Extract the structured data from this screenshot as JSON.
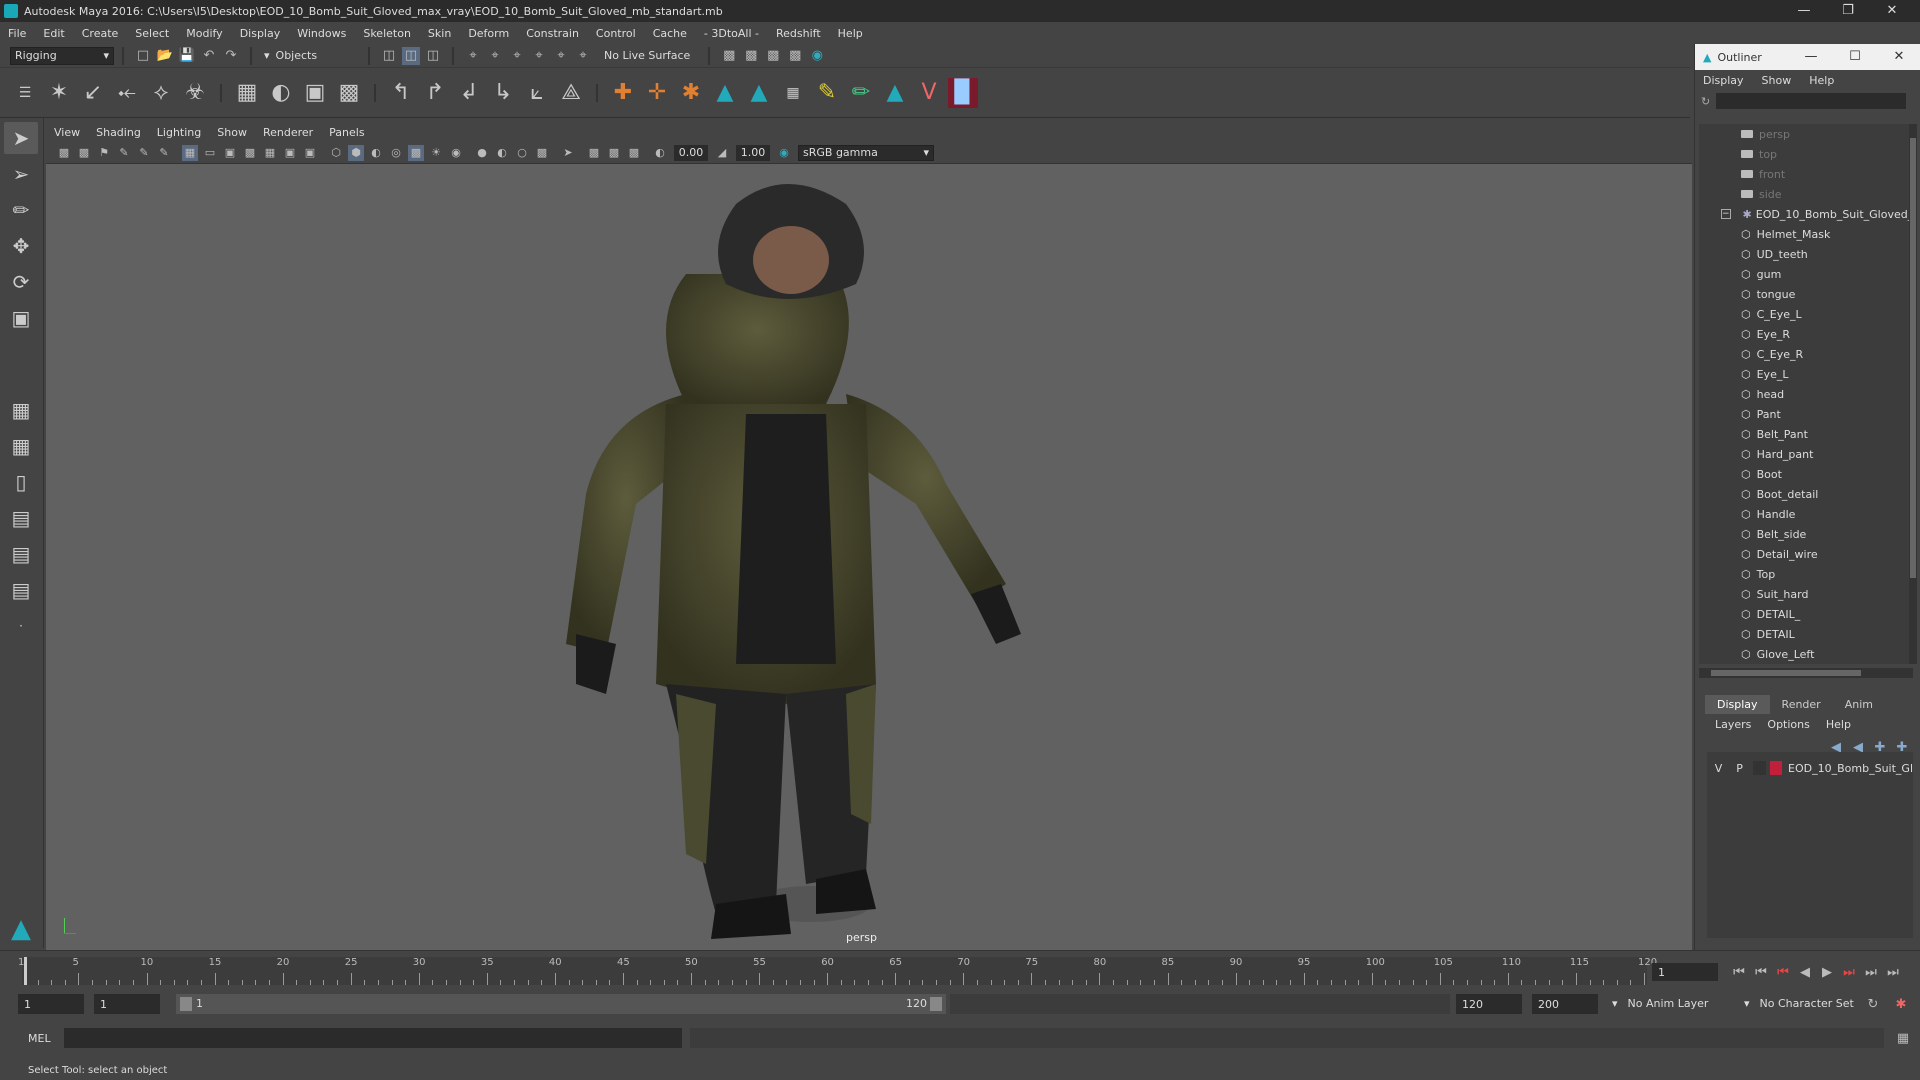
{
  "window": {
    "title": "Autodesk Maya 2016: C:\\Users\\I5\\Desktop\\EOD_10_Bomb_Suit_Gloved_max_vray\\EOD_10_Bomb_Suit_Gloved_mb_standart.mb"
  },
  "menubar": [
    "File",
    "Edit",
    "Create",
    "Select",
    "Modify",
    "Display",
    "Windows",
    "Skeleton",
    "Skin",
    "Deform",
    "Constrain",
    "Control",
    "Cache",
    "- 3DtoAll -",
    "Redshift",
    "Help"
  ],
  "status": {
    "mode": "Rigging",
    "selmode": "Objects",
    "live_surface": "No Live Surface"
  },
  "panel": {
    "menu": [
      "View",
      "Shading",
      "Lighting",
      "Show",
      "Renderer",
      "Panels"
    ],
    "exposure": "0.00",
    "gamma": "1.00",
    "colorspace": "sRGB gamma",
    "camera": "persp"
  },
  "outliner": {
    "title": "Outliner",
    "menu": [
      "Display",
      "Show",
      "Help"
    ],
    "cameras": [
      "persp",
      "top",
      "front",
      "side"
    ],
    "group": "EOD_10_Bomb_Suit_Gloved_",
    "children": [
      "Helmet_Mask",
      "UD_teeth",
      "gum",
      "tongue",
      "C_Eye_L",
      "Eye_R",
      "C_Eye_R",
      "Eye_L",
      "head",
      "Pant",
      "Belt_Pant",
      "Hard_pant",
      "Boot",
      "Boot_detail",
      "Handle",
      "Belt_side",
      "Detail_wire",
      "Top",
      "Suit_hard",
      "DETAIL_",
      "DETAIL",
      "Glove_Left"
    ]
  },
  "layers": {
    "tabs": [
      "Display",
      "Render",
      "Anim"
    ],
    "menu": [
      "Layers",
      "Options",
      "Help"
    ],
    "layer": {
      "v": "V",
      "p": "P",
      "name": "EOD_10_Bomb_Suit_Gl",
      "color": "#c0203a"
    }
  },
  "timeline": {
    "ticks": [
      "5",
      "10",
      "15",
      "20",
      "25",
      "30",
      "35",
      "40",
      "45",
      "50",
      "55",
      "60",
      "65",
      "70",
      "75",
      "80",
      "85",
      "90",
      "95",
      "100",
      "105",
      "110",
      "115",
      "120"
    ],
    "first_tick": "1",
    "current": "1"
  },
  "range": {
    "start": "1",
    "start2": "1",
    "slider_start": "1",
    "slider_end": "120",
    "end": "120",
    "max": "200",
    "anim_layer": "No Anim Layer",
    "char_set": "No Character Set"
  },
  "cmd": {
    "lang": "MEL"
  },
  "help": {
    "text": "Select Tool: select an object"
  },
  "colors": {
    "accent": "#1aa7b8",
    "suit": "#4a4a30"
  }
}
